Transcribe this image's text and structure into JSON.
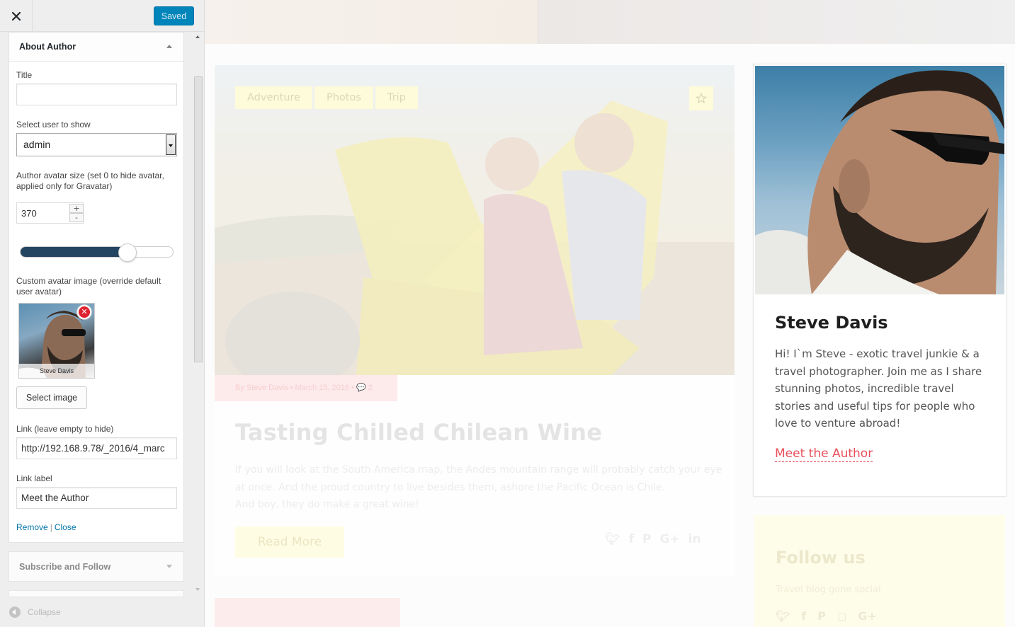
{
  "panel": {
    "saved_label": "Saved",
    "widget_title": "About Author",
    "fields": {
      "title_label": "Title",
      "title_value": "",
      "user_label": "Select user to show",
      "user_value": "admin",
      "avatar_size_label": "Author avatar size (set 0 to hide avatar, applied only for Gravatar)",
      "avatar_size_value": "370",
      "avatar_size_slider_fraction": 0.7,
      "spin_up": "+",
      "spin_down": "-",
      "custom_avatar_label": "Custom avatar image (override default user avatar)",
      "custom_avatar_name": "Steve Davis",
      "select_image_label": "Select image",
      "link_label": "Link (leave empty to hide)",
      "link_value": "http://192.168.9.78/_2016/4_marc",
      "link_label_label": "Link label",
      "link_label_value": "Meet the Author"
    },
    "actions": {
      "remove": "Remove",
      "separator": "|",
      "close": "Close"
    },
    "next_section_title": "Subscribe and Follow",
    "collapse_label": "Collapse"
  },
  "preview": {
    "post": {
      "tags": [
        "Adventure",
        "Photos",
        "Trip"
      ],
      "meta": "By Steve Davis  •  March 15, 2016  •  💬 2",
      "title": "Tasting Chilled Chilean Wine",
      "excerpt_1": "If you will look at the South America map, the Andes mountain range will probably catch your eye at once. And the proud country to live besides them, ashore the Pacific Ocean is Chile.",
      "excerpt_2": "And boy, they do make a great wine!",
      "read_more": "Read More"
    },
    "author": {
      "name": "Steve Davis",
      "bio": "Hi! I`m Steve - exotic travel junkie & a travel photographer. Join me as I share stunning photos, incredible travel stories and useful tips for people who love to venture abroad!",
      "link_label": "Meet the Author"
    },
    "follow": {
      "title": "Follow us",
      "subtitle": "Travel blog gone social"
    }
  },
  "colors": {
    "saved_button": "#0085ba",
    "slider_fill": "#234561",
    "link": "#0073aa",
    "author_link": "#e8505b"
  }
}
